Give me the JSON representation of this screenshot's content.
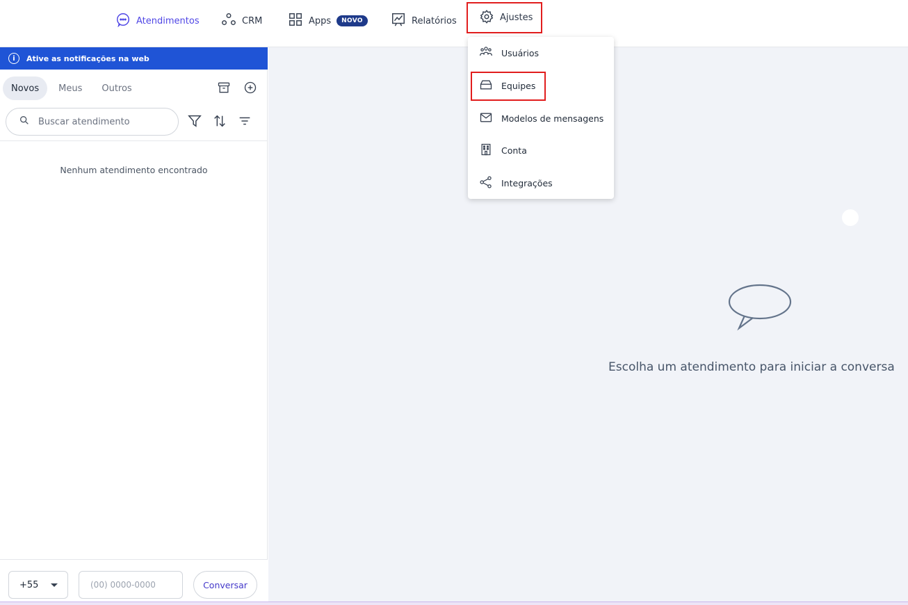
{
  "nav": {
    "items": [
      {
        "label": "Atendimentos",
        "icon": "chat-bubble-icon"
      },
      {
        "label": "CRM",
        "icon": "crm-nodes-icon"
      },
      {
        "label": "Apps",
        "icon": "apps-grid-icon",
        "badge": "NOVO"
      },
      {
        "label": "Relatórios",
        "icon": "chart-board-icon"
      },
      {
        "label": "Ajustes",
        "icon": "gear-icon"
      }
    ]
  },
  "notification": {
    "text": "Ative as notificações na web"
  },
  "tabs": [
    "Novos",
    "Meus",
    "Outros"
  ],
  "search": {
    "placeholder": "Buscar atendimento"
  },
  "list": {
    "empty_message": "Nenhum atendimento encontrado"
  },
  "bottom": {
    "country_code": "+55",
    "phone_placeholder": "(00) 0000-0000",
    "button_label": "Conversar"
  },
  "main": {
    "message": "Escolha um atendimento para iniciar a conversa"
  },
  "dropdown": {
    "items": [
      {
        "label": "Usuários",
        "icon": "users-icon"
      },
      {
        "label": "Equipes",
        "icon": "team-tray-icon"
      },
      {
        "label": "Modelos de mensagens",
        "icon": "envelope-icon"
      },
      {
        "label": "Conta",
        "icon": "building-icon"
      },
      {
        "label": "Integrações",
        "icon": "share-icon"
      }
    ]
  },
  "colors": {
    "accent": "#4f46e5",
    "notification_bg": "#1f54d6",
    "badge_bg": "#1e3a8a",
    "highlight": "#e11d1d",
    "main_bg": "#f1f3f8"
  }
}
